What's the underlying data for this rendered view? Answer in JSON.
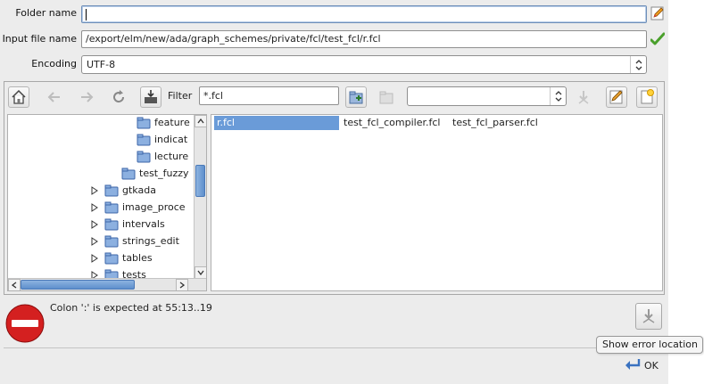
{
  "form": {
    "folder_label": "Folder name",
    "folder_value": "",
    "input_label": "Input file name",
    "input_value": "/export/elm/new/ada/graph_schemes/private/fcl/test_fcl/r.fcl",
    "encoding_label": "Encoding",
    "encoding_value": "UTF-8"
  },
  "toolbar": {
    "filter_label": "Filter",
    "filter_value": "*.fcl",
    "location_value": ""
  },
  "tree": {
    "items": [
      {
        "label": "feature"
      },
      {
        "label": "indicat"
      },
      {
        "label": "lecture"
      },
      {
        "label": "test_fuzzy"
      },
      {
        "label": "gtkada"
      },
      {
        "label": "image_proce"
      },
      {
        "label": "intervals"
      },
      {
        "label": "strings_edit"
      },
      {
        "label": "tables"
      },
      {
        "label": "tests"
      }
    ]
  },
  "files": {
    "items": [
      {
        "label": "r.fcl"
      },
      {
        "label": "test_fcl_compiler.fcl"
      },
      {
        "label": "test_fcl_parser.fcl"
      }
    ]
  },
  "message": {
    "text": "Colon ':' is expected at 55:13..19"
  },
  "tooltip": {
    "text": "Show error location"
  },
  "ok_label": "OK",
  "colors": {
    "selection": "#6a9bd8",
    "error": "#d42020",
    "folder": "#6f9ad6"
  }
}
